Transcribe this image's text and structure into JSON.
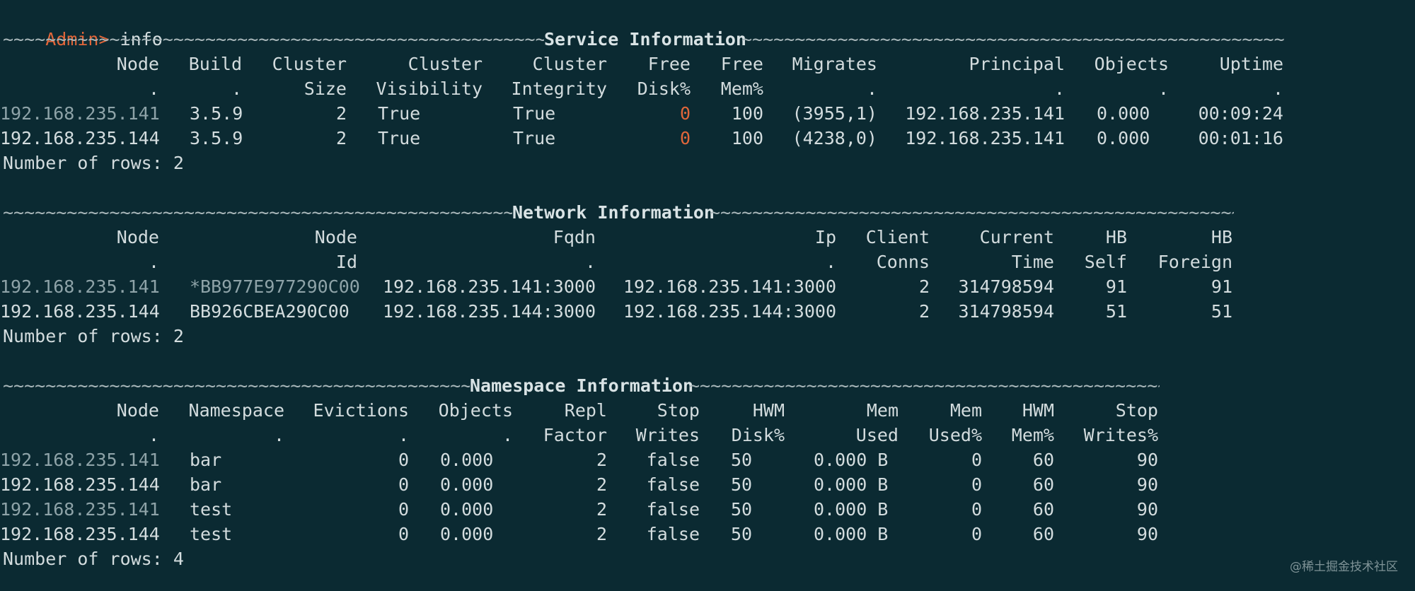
{
  "prompt": {
    "label": "Admin>",
    "command": "info"
  },
  "service": {
    "title": "Service Information",
    "headers1": [
      "Node",
      "Build",
      "Cluster",
      "Cluster",
      "Cluster",
      "Free",
      "Free",
      "Migrates",
      "Principal",
      "Objects",
      "Uptime"
    ],
    "headers2": [
      ".",
      ".",
      "Size",
      "Visibility",
      "Integrity",
      "Disk%",
      "Mem%",
      ".",
      ".",
      ".",
      "."
    ],
    "rows": [
      [
        "192.168.235.141",
        "3.5.9",
        "2",
        "True",
        "True",
        "0",
        "100",
        "(3955,1)",
        "192.168.235.141",
        "0.000",
        "00:09:24"
      ],
      [
        "192.168.235.144",
        "3.5.9",
        "2",
        "True",
        "True",
        "0",
        "100",
        "(4238,0)",
        "192.168.235.141",
        "0.000",
        "00:01:16"
      ]
    ],
    "footer": "Number of rows: 2"
  },
  "network": {
    "title": "Network Information",
    "headers1": [
      "Node",
      "Node",
      "Fqdn",
      "Ip",
      "Client",
      "Current",
      "HB",
      "HB"
    ],
    "headers2": [
      ".",
      "Id",
      ".",
      ".",
      "Conns",
      "Time",
      "Self",
      "Foreign"
    ],
    "rows": [
      [
        "192.168.235.141",
        "*BB977E977290C00",
        "192.168.235.141:3000",
        "192.168.235.141:3000",
        "2",
        "314798594",
        "91",
        "91"
      ],
      [
        "192.168.235.144",
        "BB926CBEA290C00",
        "192.168.235.144:3000",
        "192.168.235.144:3000",
        "2",
        "314798594",
        "51",
        "51"
      ]
    ],
    "footer": "Number of rows: 2"
  },
  "namespace": {
    "title": "Namespace Information",
    "headers1": [
      "Node",
      "Namespace",
      "Evictions",
      "Objects",
      "Repl",
      "Stop",
      "HWM",
      "Mem",
      "Mem",
      "HWM",
      "Stop"
    ],
    "headers2": [
      ".",
      ".",
      ".",
      ".",
      "Factor",
      "Writes",
      "Disk%",
      "Used",
      "Used%",
      "Mem%",
      "Writes%"
    ],
    "rows": [
      [
        "192.168.235.141",
        "bar",
        "0",
        "0.000",
        "2",
        "false",
        "50",
        "0.000 B",
        "0",
        "60",
        "90"
      ],
      [
        "192.168.235.144",
        "bar",
        "0",
        "0.000",
        "2",
        "false",
        "50",
        "0.000 B",
        "0",
        "60",
        "90"
      ],
      [
        "192.168.235.141",
        "test",
        "0",
        "0.000",
        "2",
        "false",
        "50",
        "0.000 B",
        "0",
        "60",
        "90"
      ],
      [
        "192.168.235.144",
        "test",
        "0",
        "0.000",
        "2",
        "false",
        "50",
        "0.000 B",
        "0",
        "60",
        "90"
      ]
    ],
    "footer": "Number of rows: 4"
  },
  "watermark": "@稀土掘金技术社区",
  "colors": {
    "background": "#0b2a32",
    "text": "#d3dcde",
    "accent": "#e0663a",
    "dim": "#8ea3a8"
  }
}
